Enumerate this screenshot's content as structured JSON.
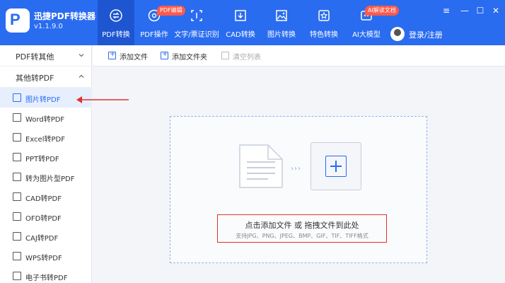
{
  "app": {
    "name": "迅捷PDF转换器",
    "version": "v1.1.9.0",
    "logo_letter": "P"
  },
  "nav": [
    {
      "label": "PDF转换",
      "icon": "convert-icon",
      "active": true
    },
    {
      "label": "PDF操作",
      "icon": "operate-icon",
      "tag": "PDF编辑"
    },
    {
      "label": "文字/票证识别",
      "icon": "ocr-icon"
    },
    {
      "label": "CAD转换",
      "icon": "cad-icon"
    },
    {
      "label": "图片转换",
      "icon": "image-icon"
    },
    {
      "label": "特色转换",
      "icon": "star-icon"
    },
    {
      "label": "AI大模型",
      "icon": "ai-icon",
      "tag": "AI解读文档"
    }
  ],
  "user": {
    "label": "登录/注册"
  },
  "window_controls": [
    "≡",
    "—",
    "☐",
    "✕"
  ],
  "sidebar": {
    "sections": [
      {
        "label": "PDF转其他",
        "expanded": false
      },
      {
        "label": "其他转PDF",
        "expanded": true
      }
    ],
    "items": [
      {
        "label": "图片转PDF",
        "active": true
      },
      {
        "label": "Word转PDF"
      },
      {
        "label": "Excel转PDF"
      },
      {
        "label": "PPT转PDF"
      },
      {
        "label": "转为图片型PDF"
      },
      {
        "label": "CAD转PDF"
      },
      {
        "label": "OFD转PDF"
      },
      {
        "label": "CAJ转PDF"
      },
      {
        "label": "WPS转PDF"
      },
      {
        "label": "电子书转PDF"
      }
    ]
  },
  "toolbar": {
    "add_file": "添加文件",
    "add_folder": "添加文件夹",
    "clear_list": "清空列表"
  },
  "dropzone": {
    "main_text": "点击添加文件 或 拖拽文件到此处",
    "sub_text": "支持JPG、PNG、JPEG、BMP、GIF、TIF、TIFF格式",
    "arrows": "›››"
  },
  "colors": {
    "brand": "#2a6cf0",
    "highlight": "#e0322b",
    "tag": "#ff5a4c"
  }
}
